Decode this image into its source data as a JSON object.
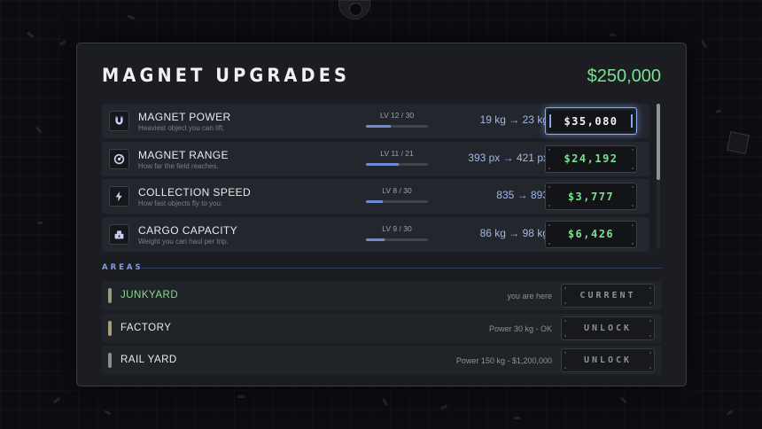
{
  "title": "MAGNET UPGRADES",
  "money": "$250,000",
  "colors": {
    "money": "#7de08e",
    "accent": "#8aa9ec",
    "text": "#e9eaec"
  },
  "upgrades": [
    {
      "name": "MAGNET POWER",
      "desc": "Heaviest object you can lift.",
      "level": "LV 12 / 30",
      "level_fraction": 0.4,
      "change": "19 kg  →  23 kg",
      "price": "$35,080",
      "icon": "magnet-icon",
      "selected": true
    },
    {
      "name": "MAGNET RANGE",
      "desc": "How far the field reaches.",
      "level": "LV 11 / 21",
      "level_fraction": 0.524,
      "change": "393 px  →  421 px",
      "price": "$24,192",
      "icon": "radar-icon",
      "selected": false
    },
    {
      "name": "COLLECTION SPEED",
      "desc": "How fast objects fly to you.",
      "level": "LV 8 / 30",
      "level_fraction": 0.267,
      "change": "835  →  893",
      "price": "$3,777",
      "icon": "lightning-icon",
      "selected": false
    },
    {
      "name": "CARGO CAPACITY",
      "desc": "Weight you can haul per trip.",
      "level": "LV 9 / 30",
      "level_fraction": 0.3,
      "change": "86 kg  →  98 kg",
      "price": "$6,426",
      "icon": "cargo-icon",
      "selected": false
    }
  ],
  "areas_heading": "AREAS",
  "areas": [
    {
      "name": "JUNKYARD",
      "info": "you are here",
      "button": "CURRENT",
      "state": "current",
      "pill_color": "#9a9a7c"
    },
    {
      "name": "FACTORY",
      "info": "Power 30 kg  -  OK",
      "button": "UNLOCK",
      "state": "unlockable",
      "pill_color": "#a79d7a"
    },
    {
      "name": "RAIL YARD",
      "info": "Power 150 kg  -  $1,200,000",
      "button": "UNLOCK",
      "state": "locked",
      "pill_color": "#8b8d90"
    }
  ]
}
